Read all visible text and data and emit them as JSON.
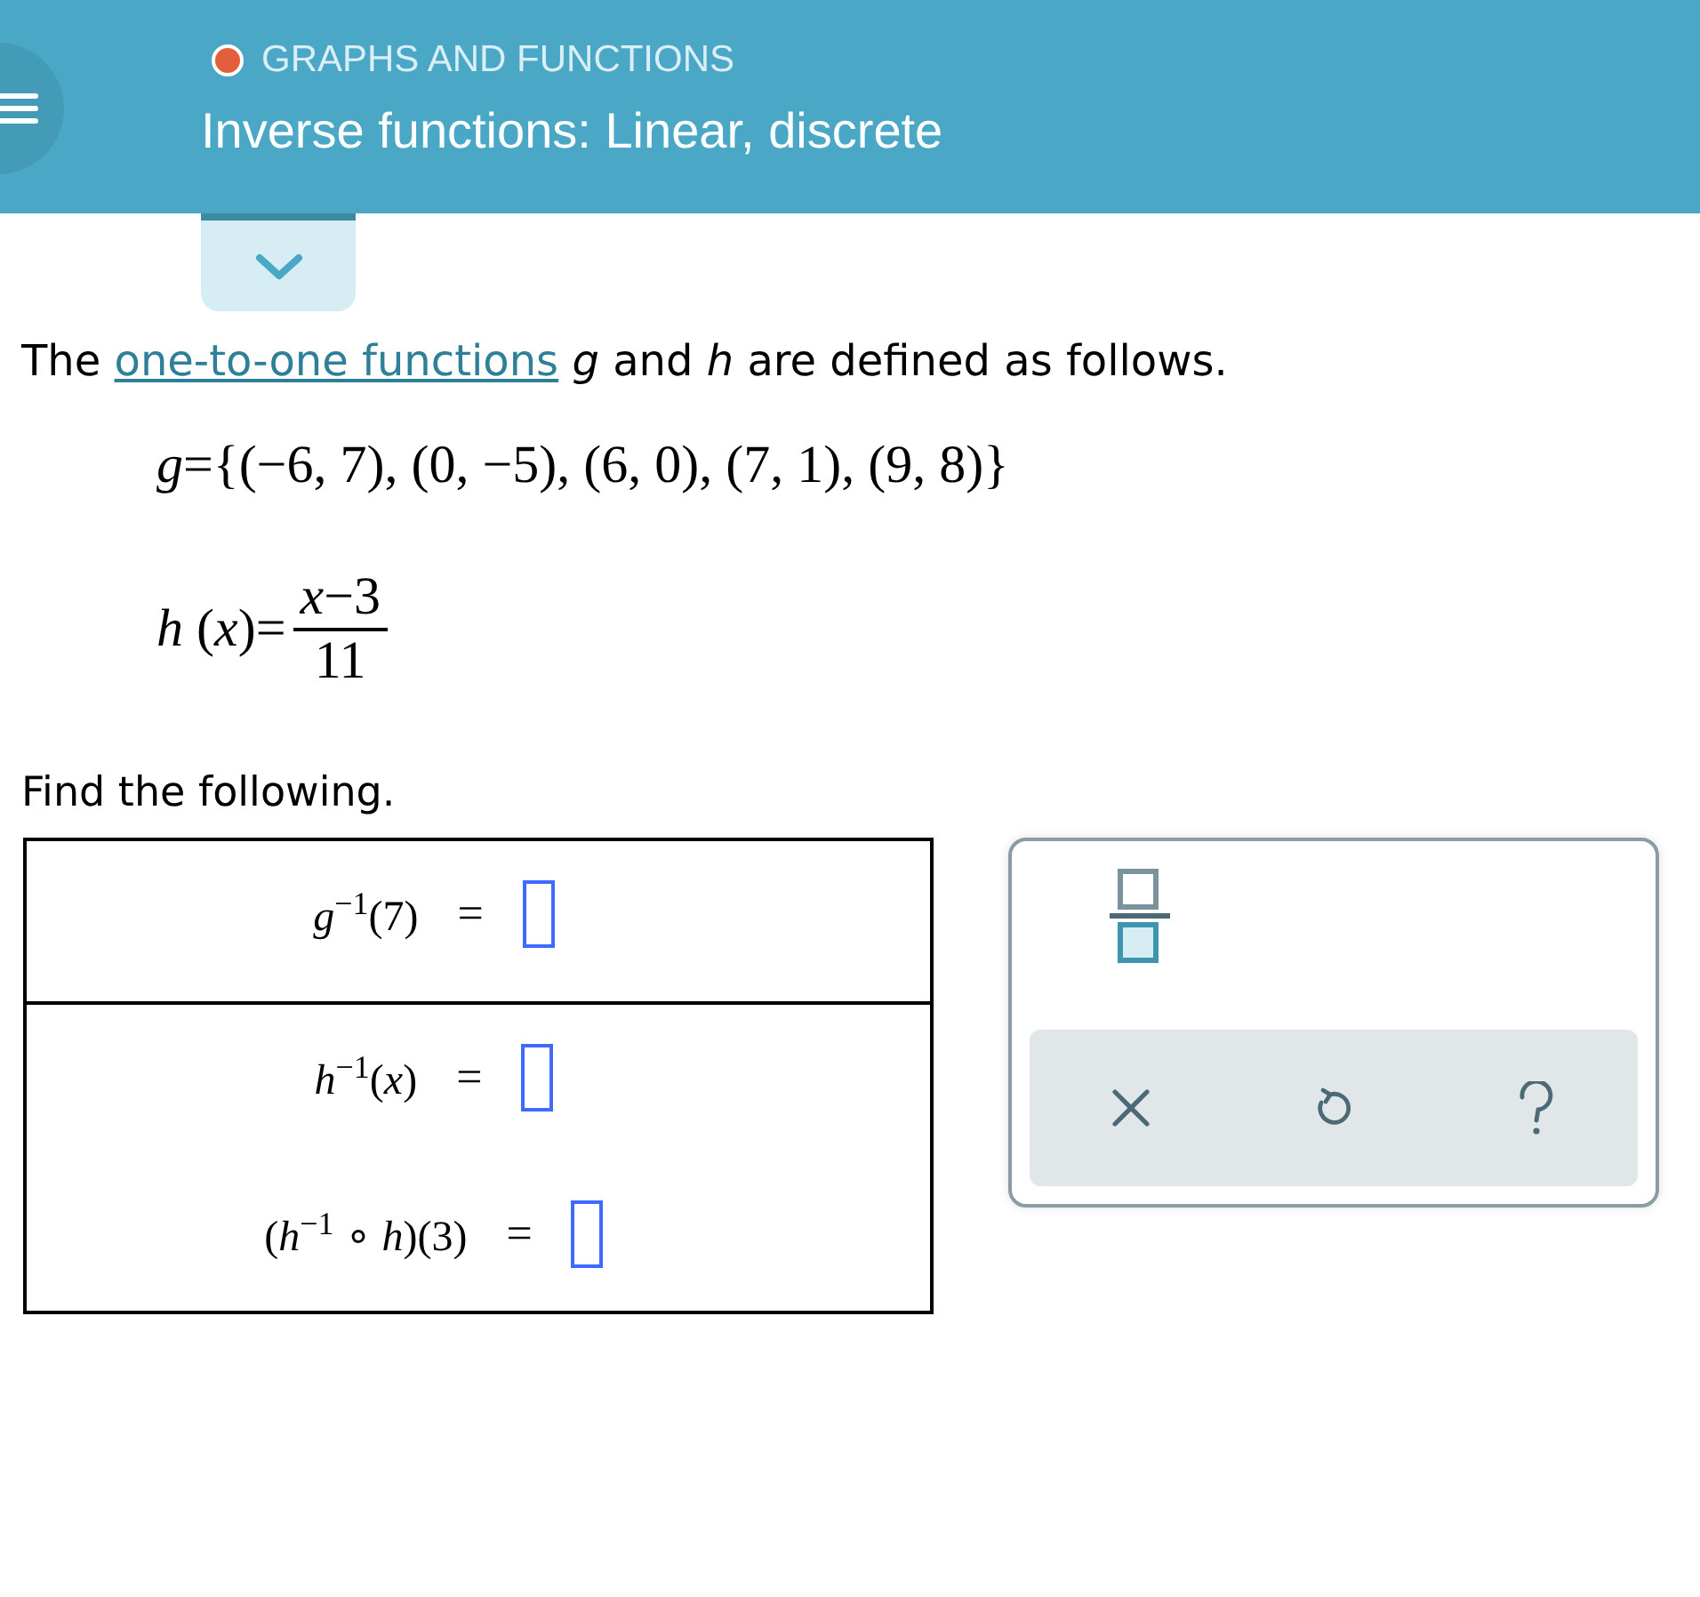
{
  "header": {
    "category": "GRAPHS AND FUNCTIONS",
    "title": "Inverse functions: Linear, discrete"
  },
  "intro": {
    "before": "The",
    "link": "one-to-one functions",
    "after": "*g* and *h* are defined as follows."
  },
  "definitions": [
    {
      "kind": "line",
      "text": "*g*={(−6, 7), (0, −5), (6, 0), (7, 1), (9, 8)}"
    },
    {
      "kind": "fraction",
      "lhs": "*h* (*x*)=",
      "numerator": "*x*−3",
      "denominator": "11"
    }
  ],
  "prompt": "Find the following.",
  "answer_table": [
    {
      "problems": [
        {
          "expression": "*g*$^{−1}$(7)",
          "equals": "="
        }
      ]
    },
    {
      "problems": [
        {
          "expression": "*h*$^{−1}$(*x*)",
          "equals": "="
        },
        {
          "expression": "(*h*$^{−1}$ ∘ *h*)(3)",
          "equals": "="
        }
      ]
    }
  ],
  "keypad": {
    "tools": [
      {
        "kind": "fraction"
      }
    ],
    "actions": [
      {
        "kind": "clear"
      },
      {
        "kind": "undo"
      },
      {
        "kind": "help"
      }
    ]
  }
}
